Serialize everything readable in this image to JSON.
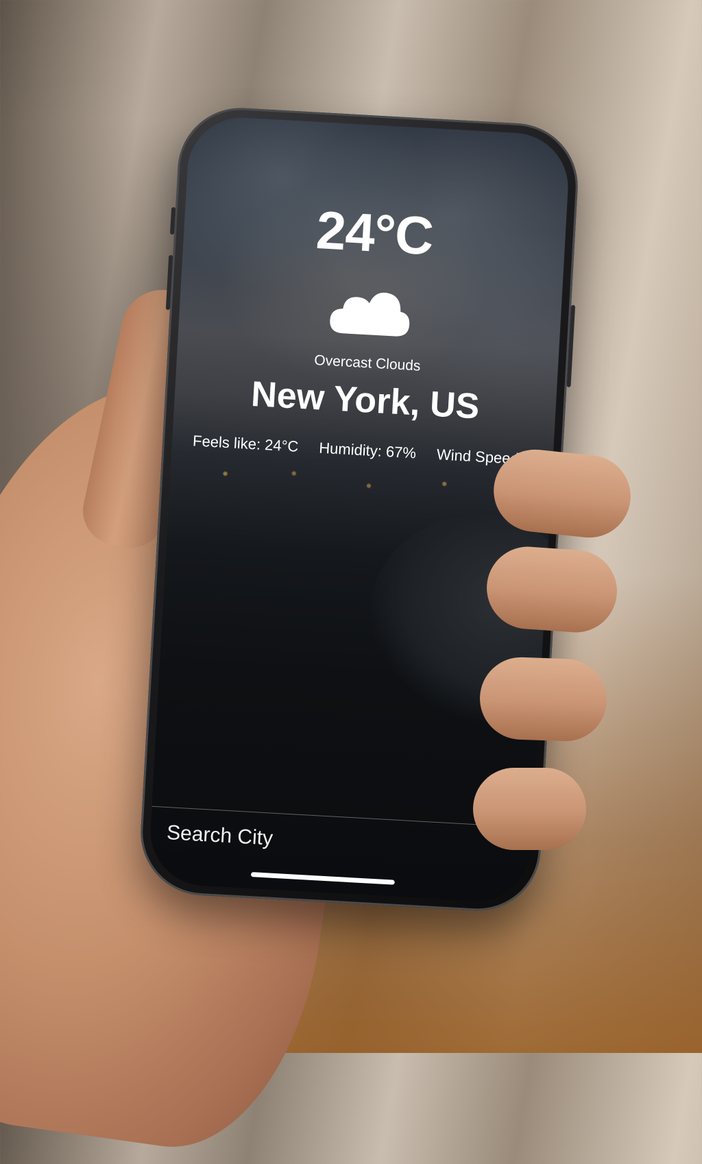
{
  "weather": {
    "temperature": "24°C",
    "condition": "Overcast Clouds",
    "city": "New York, US",
    "feels_like": "Feels like: 24°C",
    "humidity": "Humidity: 67%",
    "wind_speed": "Wind Speed:"
  },
  "search": {
    "placeholder": "Search City"
  },
  "icons": {
    "weather_icon": "cloud-icon"
  }
}
